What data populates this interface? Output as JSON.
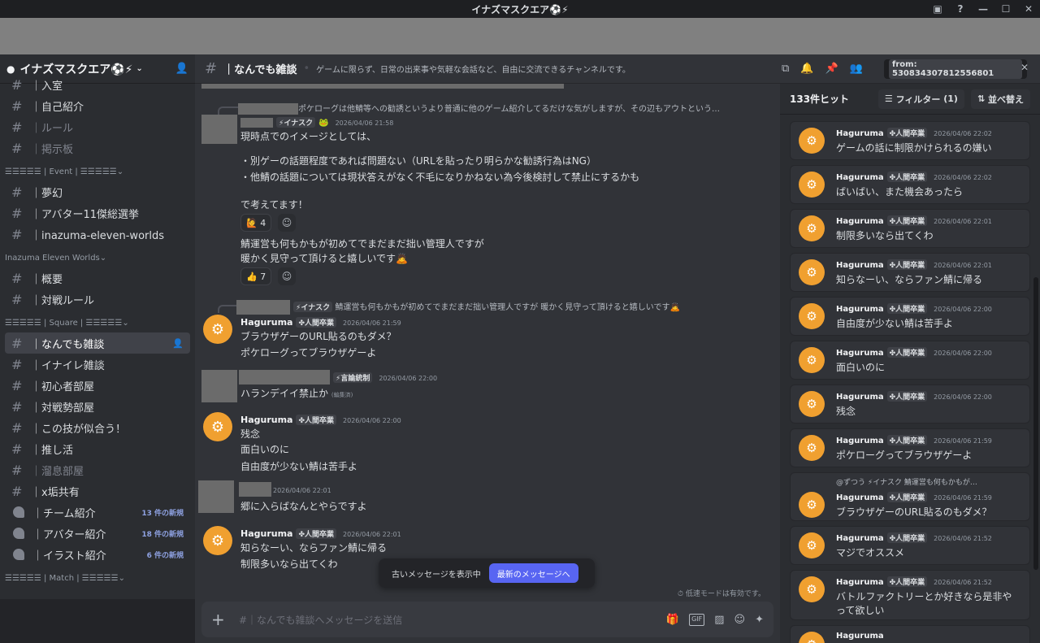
{
  "window": {
    "title": "イナズマスクエア⚽⚡",
    "controls": [
      "inbox-icon",
      "help-icon",
      "minimize",
      "maximize",
      "close"
    ]
  },
  "server": {
    "name": "イナズマスクエア⚽⚡"
  },
  "sidebar": {
    "items": [
      {
        "type": "channel",
        "label": "｜入室",
        "muted": false
      },
      {
        "type": "channel",
        "label": "｜自己紹介",
        "muted": false
      },
      {
        "type": "channel",
        "label": "｜ルール",
        "muted": true
      },
      {
        "type": "channel",
        "label": "｜掲示板",
        "muted": true
      },
      {
        "type": "category",
        "label": "☰☰☰☰☰ | Event | ☰☰☰☰☰"
      },
      {
        "type": "channel",
        "label": "｜夢幻",
        "muted": false
      },
      {
        "type": "channel",
        "label": "｜アバター11傑総選挙",
        "muted": false
      },
      {
        "type": "channel",
        "label": "｜inazuma-eleven-worlds",
        "muted": false
      },
      {
        "type": "category",
        "label": "Inazuma Eleven Worlds"
      },
      {
        "type": "channel",
        "label": "｜概要",
        "muted": false
      },
      {
        "type": "channel",
        "label": "｜対戦ルール",
        "muted": false
      },
      {
        "type": "category",
        "label": "☰☰☰☰☰ | Square | ☰☰☰☰☰"
      },
      {
        "type": "channel",
        "label": "｜なんでも雑談",
        "active": true
      },
      {
        "type": "channel",
        "label": "｜イナイレ雑談",
        "muted": false
      },
      {
        "type": "channel",
        "label": "｜初心者部屋",
        "muted": false
      },
      {
        "type": "channel",
        "label": "｜対戦勢部屋",
        "muted": false
      },
      {
        "type": "channel",
        "label": "｜この技が似合う！",
        "muted": false
      },
      {
        "type": "channel",
        "label": "｜推し活",
        "muted": false
      },
      {
        "type": "channel",
        "label": "｜溜息部屋",
        "muted": true
      },
      {
        "type": "channel",
        "label": "｜x垢共有",
        "muted": false
      },
      {
        "type": "forum",
        "label": "｜チーム紹介",
        "badge": "13 件の新規"
      },
      {
        "type": "forum",
        "label": "｜アバター紹介",
        "badge": "18 件の新規"
      },
      {
        "type": "forum",
        "label": "｜イラスト紹介",
        "badge": "6 件の新規"
      },
      {
        "type": "category",
        "label": "☰☰☰☰☰ | Match | ☰☰☰☰☰"
      }
    ]
  },
  "channel": {
    "name": "｜なんでも雑談",
    "topic": "ゲームに限らず、日常の出来事や気軽な会話など、自由に交流できるチャンネルです。"
  },
  "messages": {
    "m1": {
      "reply": "ポケローグは他鯖等への勧誘というより普通に他のゲーム紹介してるだけな気がしますが、その辺もアウトという…",
      "role": "⚡イナスク",
      "time": "2026/04/06 21:58",
      "lines": [
        "現時点でのイメージとしては、",
        "・別ゲーの話題程度であれば問題ない（URLを貼ったり明らかな勧誘行為はNG）",
        "・他鯖の話題については現状答えがなく不毛になりかねない為今後検討して禁止にするかも",
        "で考えてます！"
      ],
      "reaction1": {
        "emoji": "🙋",
        "count": "4"
      },
      "lines2": [
        "鯖運営も何もかもが初めてでまだまだ拙い管理人ですが",
        "暖かく見守って頂けると嬉しいです🙇"
      ],
      "reaction2": {
        "emoji": "👍",
        "count": "7"
      }
    },
    "m2": {
      "reply_role": "⚡イナスク",
      "reply": "鯖運営も何もかもが初めてでまだまだ拙い管理人ですが 暖かく見守って頂けると嬉しいです🙇",
      "user": "Haguruma",
      "role": "✤人間卒業",
      "time": "2026/04/06 21:59",
      "lines": [
        "ブラウザゲーのURL貼るのもダメ？",
        "ポケローグってブラウザゲーよ"
      ]
    },
    "m3": {
      "role": "⚡言論統制",
      "time": "2026/04/06 22:00",
      "text": "ハランデイイ禁止か",
      "edited": "(編集済)"
    },
    "m4": {
      "user": "Haguruma",
      "role": "✤人間卒業",
      "time": "2026/04/06 22:00",
      "lines": [
        "残念",
        "面白いのに",
        "自由度が少ない鯖は苦手よ"
      ]
    },
    "m5": {
      "time": "2026/04/06 22:01",
      "text": "郷に入らばなんとやらですよ"
    },
    "m6": {
      "user": "Haguruma",
      "role": "✤人間卒業",
      "time": "2026/04/06 22:01",
      "lines": [
        "知らなーい、ならファン鯖に帰る",
        "制限多いなら出てくわ"
      ]
    }
  },
  "jumpbar": {
    "old_label": "古いメッセージを表示中",
    "jump_label": "最新のメッセージへ"
  },
  "slowmode": "低速モードは有効です。",
  "composer": {
    "placeholder": "#｜なんでも雑談へメッセージを送信"
  },
  "search": {
    "query": "from: 530834307812556801",
    "hits": "133件ヒット",
    "filter_label": "フィルター",
    "filter_count": "(1)",
    "sort_label": "並べ替え",
    "results": [
      {
        "user": "Haguruma",
        "role": "✤人間卒業",
        "time": "2026/04/06 22:02",
        "text": "ゲームの話に制限かけられるの嫌い"
      },
      {
        "user": "Haguruma",
        "role": "✤人間卒業",
        "time": "2026/04/06 22:02",
        "text": "ばいばい、また機会あったら"
      },
      {
        "user": "Haguruma",
        "role": "✤人間卒業",
        "time": "2026/04/06 22:01",
        "text": "制限多いなら出てくわ"
      },
      {
        "user": "Haguruma",
        "role": "✤人間卒業",
        "time": "2026/04/06 22:01",
        "text": "知らなーい、ならファン鯖に帰る"
      },
      {
        "user": "Haguruma",
        "role": "✤人間卒業",
        "time": "2026/04/06 22:00",
        "text": "自由度が少ない鯖は苦手よ"
      },
      {
        "user": "Haguruma",
        "role": "✤人間卒業",
        "time": "2026/04/06 22:00",
        "text": "面白いのに"
      },
      {
        "user": "Haguruma",
        "role": "✤人間卒業",
        "time": "2026/04/06 22:00",
        "text": "残念"
      },
      {
        "user": "Haguruma",
        "role": "✤人間卒業",
        "time": "2026/04/06 21:59",
        "text": "ポケローグってブラウザゲーよ"
      },
      {
        "user": "Haguruma",
        "role": "✤人間卒業",
        "time": "2026/04/06 21:59",
        "text": "ブラウザゲーのURL貼るのもダメ？",
        "reply": "@ずつう ⚡イナスク 鯖運営も何もかもが…"
      },
      {
        "user": "Haguruma",
        "role": "✤人間卒業",
        "time": "2026/04/06 21:52",
        "text": "マジでオススメ"
      },
      {
        "user": "Haguruma",
        "role": "✤人間卒業",
        "time": "2026/04/06 21:52",
        "text": "バトルファクトリーとか好きなら是非や",
        "text2": "って欲しい"
      },
      {
        "user": "Haguruma"
      }
    ]
  },
  "colors": {
    "accent": "#5865f2",
    "sidebar": "#2b2d31",
    "chat": "#313338",
    "grey_band": "#808080"
  }
}
